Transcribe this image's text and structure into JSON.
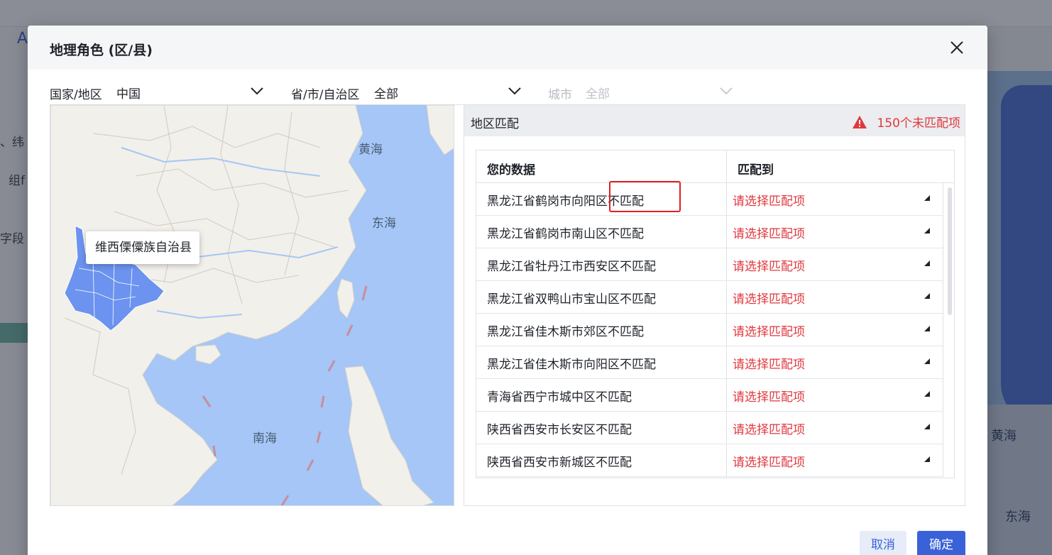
{
  "background": {
    "frag1": "、纬",
    "frag2": "组f",
    "frag3": "字段",
    "frag4": "A",
    "sea1": "黄海",
    "sea2": "东海"
  },
  "dialog": {
    "title": "地理角色 (区/县)",
    "close_icon": "close-icon"
  },
  "filters": {
    "country": {
      "label": "国家/地区",
      "value": "中国"
    },
    "province": {
      "label": "省/市/自治区",
      "value": "全部"
    },
    "city": {
      "label": "城市",
      "value": "全部",
      "disabled": true
    }
  },
  "map": {
    "tooltip": "维西傈僳族自治县",
    "labels": {
      "huanghai": "黄海",
      "donghai": "东海",
      "nanhai": "南海"
    },
    "highlight_color": "#6b93ef",
    "water_color": "#a5c6f6",
    "land_color": "#f2f0ea"
  },
  "match_panel": {
    "title": "地区匹配",
    "warning": "150个未匹配项",
    "warning_icon": "warning-triangle-icon",
    "columns": {
      "data": "您的数据",
      "match": "匹配到"
    },
    "rows": [
      {
        "data": "黑龙江省鹤岗市向阳区不匹配",
        "match": "请选择匹配项"
      },
      {
        "data": "黑龙江省鹤岗市南山区不匹配",
        "match": "请选择匹配项"
      },
      {
        "data": "黑龙江省牡丹江市西安区不匹配",
        "match": "请选择匹配项"
      },
      {
        "data": "黑龙江省双鸭山市宝山区不匹配",
        "match": "请选择匹配项"
      },
      {
        "data": "黑龙江省佳木斯市郊区不匹配",
        "match": "请选择匹配项"
      },
      {
        "data": "黑龙江省佳木斯市向阳区不匹配",
        "match": "请选择匹配项"
      },
      {
        "data": "青海省西宁市城中区不匹配",
        "match": "请选择匹配项"
      },
      {
        "data": "陕西省西安市长安区不匹配",
        "match": "请选择匹配项"
      },
      {
        "data": "陕西省西安市新城区不匹配",
        "match": "请选择匹配项"
      }
    ]
  },
  "footer": {
    "cancel": "取消",
    "confirm": "确定"
  }
}
